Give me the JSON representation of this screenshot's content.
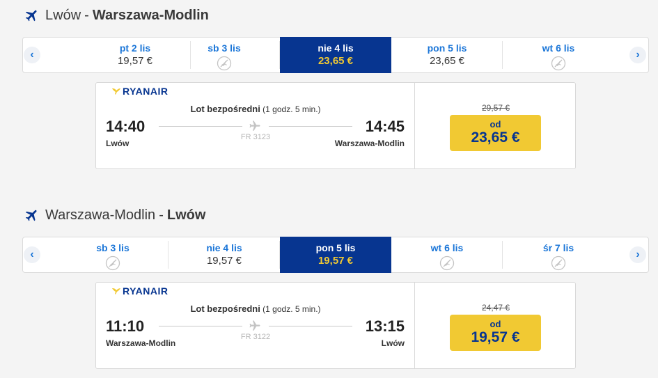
{
  "outbound": {
    "title_from": "Lwów",
    "title_sep": "-",
    "title_to": "Warszawa-Modlin",
    "days": [
      {
        "label": "pt 2 lis",
        "price": "19,57 €"
      },
      {
        "label": "sb 3 lis",
        "price": ""
      },
      {
        "label": "nie 4 lis",
        "price": "23,65 €"
      },
      {
        "label": "pon 5 lis",
        "price": "23,65 €"
      },
      {
        "label": "wt 6 lis",
        "price": ""
      }
    ],
    "selected_index": 2,
    "card": {
      "airline": "RYANAIR",
      "direct_label": "Lot bezpośredni",
      "duration": "(1 godz. 5 min.)",
      "dep_time": "14:40",
      "arr_time": "14:45",
      "dep_place": "Lwów",
      "arr_place": "Warszawa-Modlin",
      "flight_no": "FR 3123",
      "old_price": "29,57 €",
      "price_prefix": "od",
      "price": "23,65 €"
    }
  },
  "inbound": {
    "title_from": "Warszawa-Modlin",
    "title_sep": "-",
    "title_to": "Lwów",
    "days": [
      {
        "label": "sb 3 lis",
        "price": ""
      },
      {
        "label": "nie 4 lis",
        "price": "19,57 €"
      },
      {
        "label": "pon 5 lis",
        "price": "19,57 €"
      },
      {
        "label": "wt 6 lis",
        "price": ""
      },
      {
        "label": "śr 7 lis",
        "price": ""
      }
    ],
    "selected_index": 2,
    "card": {
      "airline": "RYANAIR",
      "direct_label": "Lot bezpośredni",
      "duration": "(1 godz. 5 min.)",
      "dep_time": "11:10",
      "arr_time": "13:15",
      "dep_place": "Warszawa-Modlin",
      "arr_place": "Lwów",
      "flight_no": "FR 3122",
      "old_price": "24,47 €",
      "price_prefix": "od",
      "price": "19,57 €"
    }
  },
  "icons": {
    "plane": "airplane-icon",
    "no_flight": "no-flight-icon",
    "prev": "chevron-left-icon",
    "next": "chevron-right-icon",
    "logo": "ryanair-harp-icon"
  },
  "colors": {
    "brand_blue": "#073590",
    "accent_yellow": "#f1c933",
    "link_blue": "#1b76d8"
  }
}
